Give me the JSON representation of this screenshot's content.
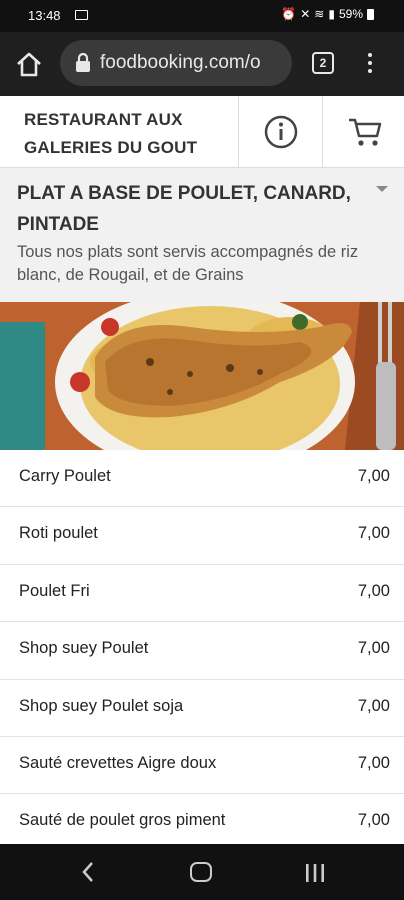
{
  "status_bar": {
    "time": "13:48",
    "battery": "59%"
  },
  "browser": {
    "url": "foodbooking.com/o",
    "tab_count": "2"
  },
  "header": {
    "restaurant_name": "RESTAURANT AUX GALERIES DU GOUT"
  },
  "category": {
    "title": "PLAT A BASE DE POULET, CANARD, PINTADE",
    "description": "Tous nos plats sont servis accompagnés de riz blanc, de Rougail, et de Grains"
  },
  "menu": {
    "items": [
      {
        "name": "Carry Poulet",
        "price": "7,00"
      },
      {
        "name": "Roti poulet",
        "price": "7,00"
      },
      {
        "name": "Poulet Fri",
        "price": "7,00"
      },
      {
        "name": "Shop suey Poulet",
        "price": "7,00"
      },
      {
        "name": "Shop suey Poulet soja",
        "price": "7,00"
      },
      {
        "name": "Sauté crevettes Aigre doux",
        "price": "7,00"
      },
      {
        "name": "Sauté de poulet gros piment",
        "price": "7,00"
      }
    ]
  },
  "colors": {
    "status_bar": "#111111",
    "browser_bar": "#1f1f1f",
    "category_bg": "#f1f1f1",
    "text": "#333333"
  },
  "icons": {
    "home": "home-icon",
    "lock": "lock-icon",
    "tabs": "tab-switcher-icon",
    "menu": "more-vert-icon",
    "info": "info-icon",
    "cart": "cart-icon",
    "caret": "caret-down-icon",
    "back": "back-icon",
    "home_nav": "nav-home-icon",
    "recent": "recent-apps-icon"
  }
}
